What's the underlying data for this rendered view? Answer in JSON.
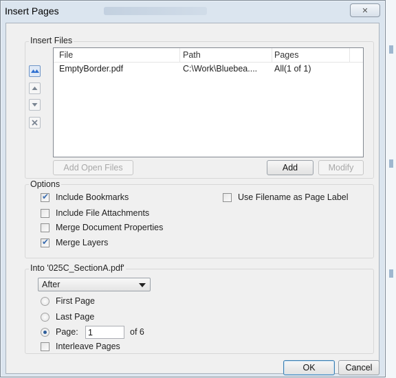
{
  "dialog": {
    "title": "Insert Pages",
    "close_glyph": "✕"
  },
  "insert_files": {
    "legend": "Insert Files",
    "columns": [
      "File",
      "Path",
      "Pages"
    ],
    "rows": [
      {
        "file": "EmptyBorder.pdf",
        "path": "C:\\Work\\Bluebea....",
        "pages": "All(1 of 1)"
      }
    ],
    "side_buttons": [
      "move-top-icon",
      "move-up-icon",
      "move-down-icon",
      "remove-icon"
    ],
    "add_open_files_label": "Add Open Files",
    "add_label": "Add",
    "modify_label": "Modify"
  },
  "options": {
    "legend": "Options",
    "include_bookmarks": {
      "label": "Include Bookmarks",
      "checked": true
    },
    "include_attachments": {
      "label": "Include File Attachments",
      "checked": false
    },
    "merge_properties": {
      "label": "Merge Document Properties",
      "checked": false
    },
    "merge_layers": {
      "label": "Merge Layers",
      "checked": true
    },
    "use_filename": {
      "label": "Use Filename as Page Label",
      "checked": false
    }
  },
  "into": {
    "legend": "Into '025C_SectionA.pdf'",
    "position_value": "After",
    "first_page_label": "First Page",
    "last_page_label": "Last Page",
    "page_label": "Page:",
    "page_value": "1",
    "page_of": "of 6",
    "selected_radio": "page",
    "interleave_label": "Interleave Pages",
    "interleave_checked": false
  },
  "footer": {
    "ok_label": "OK",
    "cancel_label": "Cancel"
  },
  "colors": {
    "accent": "#3a6db0",
    "selected_arrow": "#2f6fd0"
  }
}
